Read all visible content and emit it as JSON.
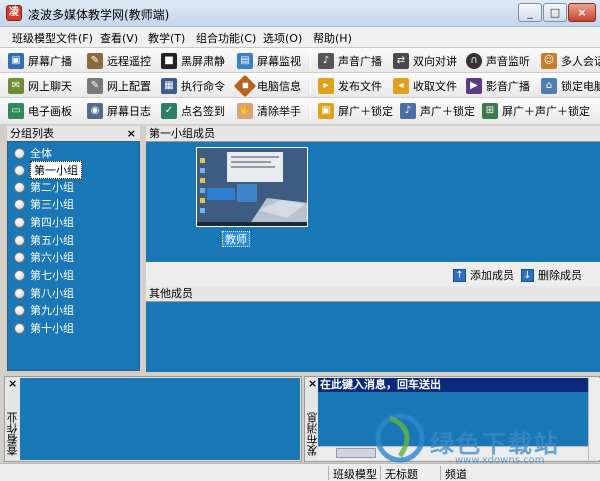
{
  "window": {
    "title": "凌波多媒体教学网(教师端)",
    "controls": [
      "_",
      "□",
      "×"
    ]
  },
  "menu": [
    "班级模型文件(F)",
    "查看(V)",
    "教学(T)",
    "组合功能(C)",
    "选项(O)",
    "帮助(H)"
  ],
  "toolbar": {
    "row1": [
      "屏幕广播",
      "远程遥控",
      "黑屏肃静",
      "屏幕监视",
      "声音广播",
      "双向对讲",
      "声音监听",
      "多人会话"
    ],
    "row2": [
      "网上聊天",
      "网上配置",
      "执行命令",
      "电脑信息",
      "发布文件",
      "收取文件",
      "影音广播",
      "锁定电脑"
    ],
    "row3": [
      "电子画板",
      "屏幕日志",
      "点名签到",
      "清除举手",
      "屏广＋锁定",
      "声广＋锁定",
      "屏广＋声广＋锁定"
    ]
  },
  "groups": {
    "title": "分组列表",
    "close": "×",
    "items": [
      "全体",
      "第一小组",
      "第二小组",
      "第三小组",
      "第四小组",
      "第五小组",
      "第六小组",
      "第七小组",
      "第八小组",
      "第九小组",
      "第十小组"
    ],
    "selected": "第一小组"
  },
  "members": {
    "title": "第一小组成员",
    "teacher_label": "教师",
    "add_label": "添加成员",
    "remove_label": "删除成员"
  },
  "others": {
    "title": "其他成员"
  },
  "homework": {
    "close": "×",
    "label": "查看作业"
  },
  "messages": {
    "close": "×",
    "label": "发布消息",
    "input_value": "在此键入消息，回车送出"
  },
  "status": {
    "model": "班级模型",
    "title_part": "无标题",
    "clock": "频道"
  },
  "watermark": {
    "text": "绿色下载站",
    "url": "www.xdowns.com"
  },
  "colors": {
    "panel_blue": "#1a77b6",
    "chrome": "#d4d0c8"
  }
}
